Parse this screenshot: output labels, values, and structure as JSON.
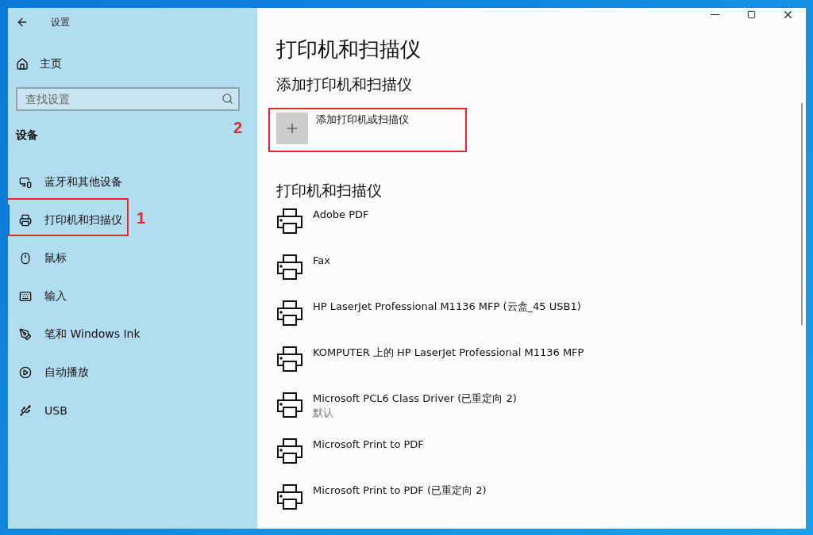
{
  "window": {
    "title": "设置"
  },
  "sidebar": {
    "home": "主页",
    "search": {
      "placeholder": "查找设置"
    },
    "section": "设备",
    "items": [
      {
        "label": "蓝牙和其他设备",
        "selected": false
      },
      {
        "label": "打印机和扫描仪",
        "selected": true,
        "callout": "1"
      },
      {
        "label": "鼠标",
        "selected": false
      },
      {
        "label": "输入",
        "selected": false
      },
      {
        "label": "笔和 Windows Ink",
        "selected": false
      },
      {
        "label": "自动播放",
        "selected": false
      },
      {
        "label": "USB",
        "selected": false
      }
    ]
  },
  "content": {
    "title": "打印机和扫描仪",
    "add_heading": "添加打印机和扫描仪",
    "add_button": {
      "label": "添加打印机或扫描仪",
      "callout": "2"
    },
    "list_heading": "打印机和扫描仪",
    "printers": [
      {
        "name": "Adobe PDF"
      },
      {
        "name": "Fax"
      },
      {
        "name": "HP LaserJet Professional M1136 MFP (云盒_45 USB1)"
      },
      {
        "name": "KOMPUTER 上的 HP LaserJet Professional M1136 MFP"
      },
      {
        "name": "Microsoft PCL6 Class Driver (已重定向 2)",
        "status": "默认"
      },
      {
        "name": "Microsoft Print to PDF"
      },
      {
        "name": "Microsoft Print to PDF (已重定向 2)"
      }
    ]
  }
}
